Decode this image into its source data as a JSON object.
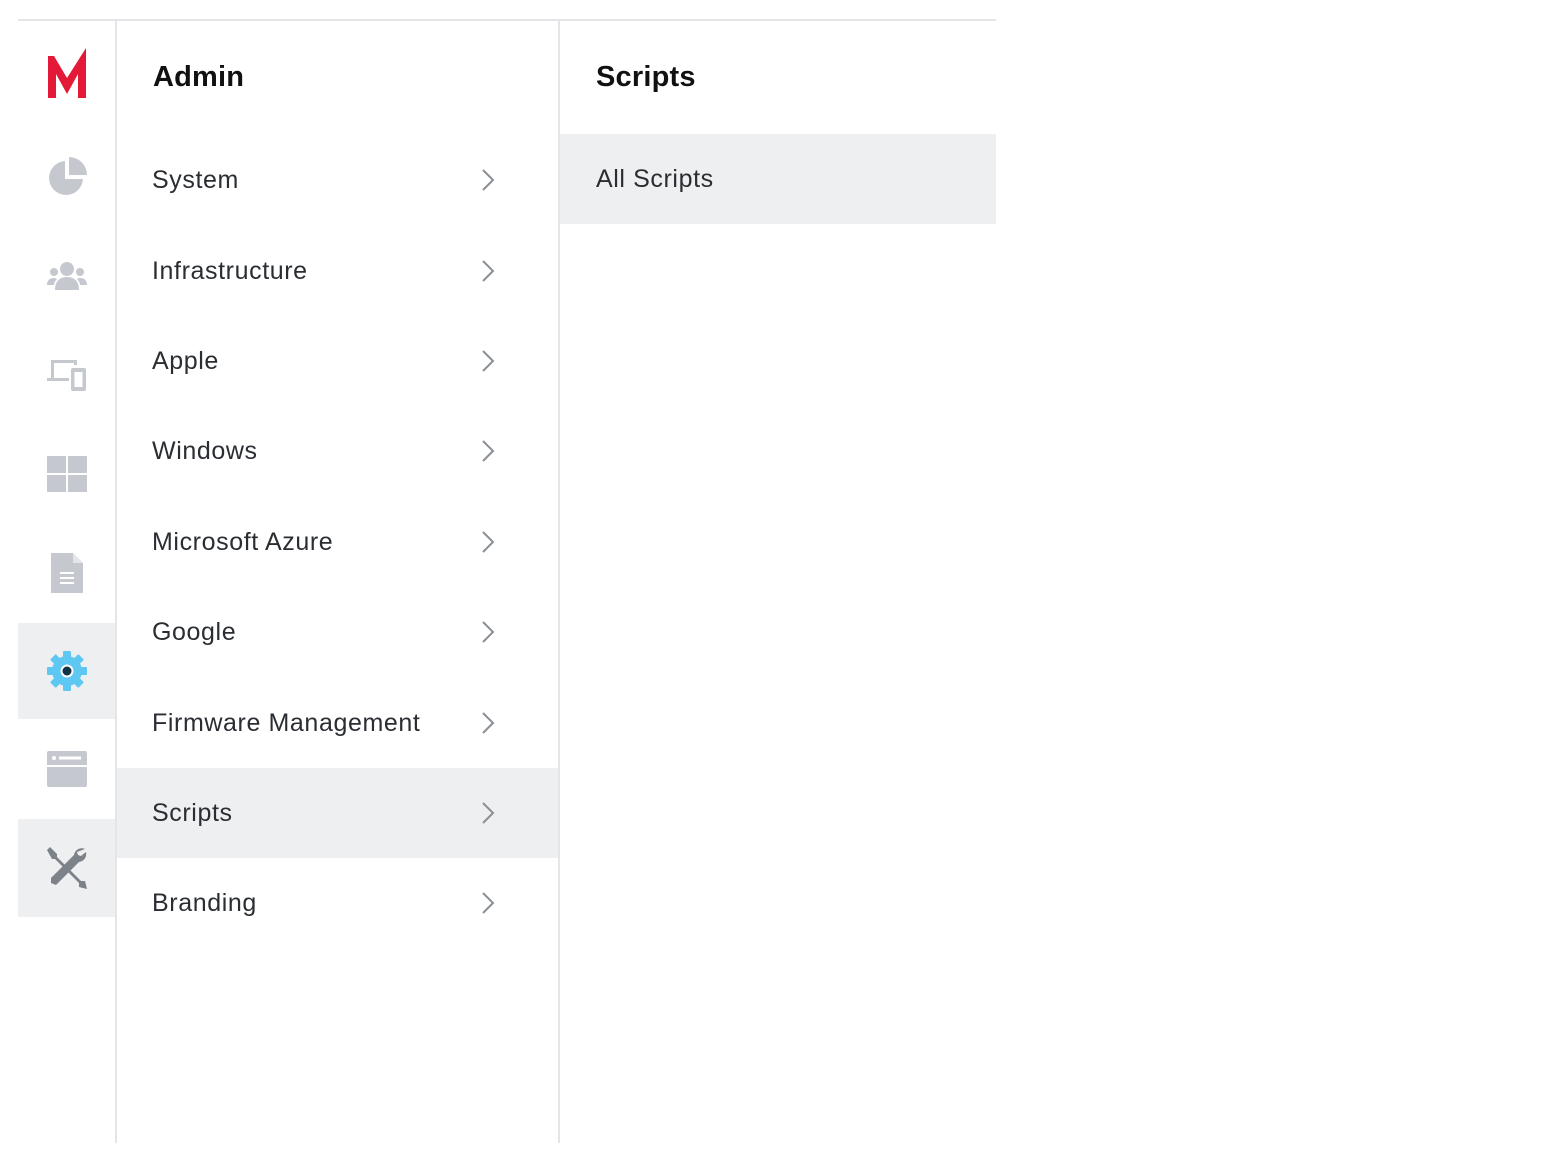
{
  "colors": {
    "brand": "#e31937",
    "icon_gray": "#c5c9cf",
    "active_icon": "#5ec8f2",
    "active_bg": "#eeeff1",
    "divider": "#e3e5e8"
  },
  "rail": {
    "items": [
      {
        "icon": "brand-logo-icon",
        "active": false
      },
      {
        "icon": "dashboard-pie-icon",
        "active": false
      },
      {
        "icon": "users-icon",
        "active": false
      },
      {
        "icon": "devices-icon",
        "active": false
      },
      {
        "icon": "apps-grid-icon",
        "active": false
      },
      {
        "icon": "policies-document-icon",
        "active": false
      },
      {
        "icon": "admin-gear-icon",
        "active": true
      },
      {
        "icon": "browser-window-icon",
        "active": false
      },
      {
        "icon": "tools-icon",
        "active": true
      }
    ]
  },
  "admin": {
    "title": "Admin",
    "items": [
      {
        "label": "System",
        "active": false
      },
      {
        "label": "Infrastructure",
        "active": false
      },
      {
        "label": "Apple",
        "active": false
      },
      {
        "label": "Windows",
        "active": false
      },
      {
        "label": "Microsoft Azure",
        "active": false
      },
      {
        "label": "Google",
        "active": false
      },
      {
        "label": "Firmware Management",
        "active": false
      },
      {
        "label": "Scripts",
        "active": true
      },
      {
        "label": "Branding",
        "active": false
      }
    ]
  },
  "scripts": {
    "title": "Scripts",
    "items": [
      {
        "label": "All Scripts",
        "active": true
      }
    ]
  }
}
